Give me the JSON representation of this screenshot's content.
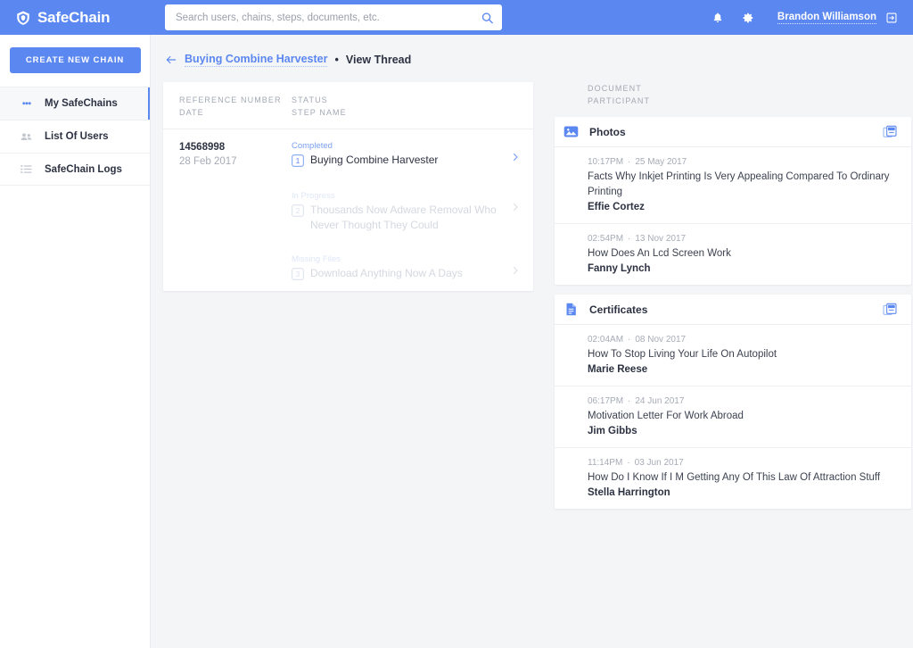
{
  "app": {
    "brand": "SafeChain",
    "brand_icon": "shield-icon"
  },
  "search": {
    "placeholder": "Search users, chains, steps, documents, etc.",
    "value": "",
    "icon": "search-icon"
  },
  "topbar": {
    "notifications_icon": "bell-icon",
    "settings_icon": "gear-icon",
    "user_name": "Brandon Williamson",
    "logout_icon": "logout-icon"
  },
  "sidebar": {
    "create_button": "CREATE NEW CHAIN",
    "items": [
      {
        "label": "My SafeChains",
        "icon": "chain-links-icon",
        "active": true
      },
      {
        "label": "List Of Users",
        "icon": "users-icon",
        "active": false
      },
      {
        "label": "SafeChain Logs",
        "icon": "list-icon",
        "active": false
      }
    ]
  },
  "breadcrumb": {
    "back_icon": "arrow-left-icon",
    "link": "Buying Combine Harvester",
    "separator": "•",
    "current": "View Thread"
  },
  "steps_panel": {
    "headers": {
      "col1_line1": "REFERENCE NUMBER",
      "col1_line2": "DATE",
      "col2_line1": "STATUS",
      "col2_line2": "STEP NAME"
    },
    "rows": [
      {
        "reference": "14568998",
        "date": "28 Feb 2017",
        "status": "Completed",
        "step_name": "Buying Combine Harvester",
        "badge": "1",
        "faded": false
      },
      {
        "reference": "",
        "date": "",
        "status": "In Progress",
        "step_name": "Thousands Now Adware Removal Who Never Thought They Could",
        "badge": "2",
        "faded": true
      },
      {
        "reference": "",
        "date": "",
        "status": "Missing Files",
        "step_name": "Download Anything Now A Days",
        "badge": "3",
        "faded": true
      }
    ]
  },
  "documents_panel": {
    "headers": {
      "line1": "DOCUMENT",
      "line2": "PARTICIPANT"
    },
    "groups": [
      {
        "title": "Photos",
        "icon": "photo-icon",
        "collapse_icon": "collapse-icon",
        "items": [
          {
            "time": "10:17PM",
            "date": "25 May 2017",
            "title": "Facts Why Inkjet Printing Is Very Appealing Compared To Ordinary Printing",
            "person": "Effie Cortez"
          },
          {
            "time": "02:54PM",
            "date": "13 Nov 2017",
            "title": "How Does An Lcd Screen Work",
            "person": "Fanny Lynch"
          }
        ]
      },
      {
        "title": "Certificates",
        "icon": "document-icon",
        "collapse_icon": "collapse-icon",
        "items": [
          {
            "time": "02:04AM",
            "date": "08 Nov 2017",
            "title": "How To Stop Living Your Life On Autopilot",
            "person": "Marie Reese"
          },
          {
            "time": "06:17PM",
            "date": "24 Jun 2017",
            "title": "Motivation Letter For Work Abroad",
            "person": "Jim Gibbs"
          },
          {
            "time": "11:14PM",
            "date": "03 Jun 2017",
            "title": "How Do I Know If I M Getting Any Of This Law Of Attraction Stuff",
            "person": "Stella Harrington"
          }
        ]
      }
    ]
  },
  "colors": {
    "brand_blue": "#5b87f0",
    "page_bg": "#f4f5f7",
    "text_dark": "#2c3242",
    "text_muted": "#a6abb6"
  }
}
